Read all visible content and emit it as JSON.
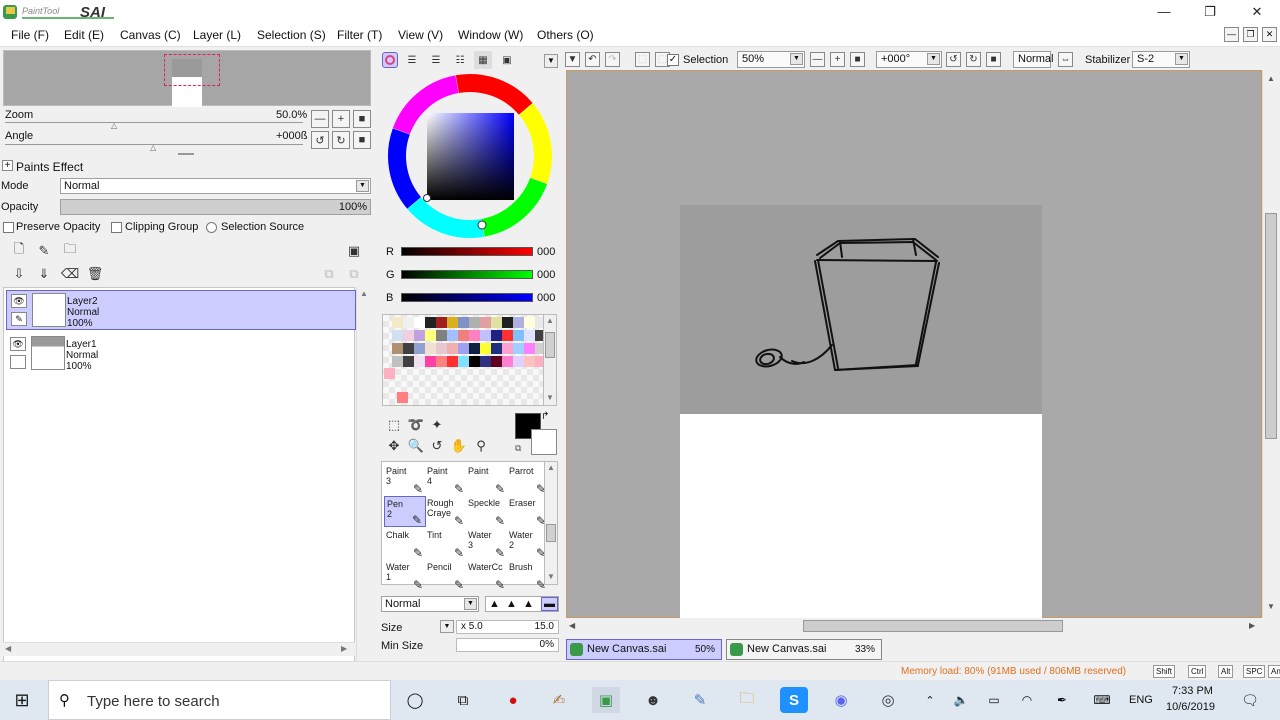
{
  "app": {
    "name": "SAI",
    "brand": "PaintTool"
  },
  "window_controls": {
    "minimize": "—",
    "restore": "❐",
    "close": "✕"
  },
  "menu": [
    "File (F)",
    "Edit (E)",
    "Canvas (C)",
    "Layer (L)",
    "Selection (S)",
    "Filter (T)",
    "View (V)",
    "Window (W)",
    "Others (O)"
  ],
  "navigator": {
    "zoom_label": "Zoom",
    "zoom_value": "50.0%",
    "angle_label": "Angle",
    "angle_value": "+000ß"
  },
  "layer_props": {
    "paints_effect": "Paints Effect",
    "mode_label": "Mode",
    "mode_value": "Normal",
    "opacity_label": "Opacity",
    "opacity_value": "100%",
    "preserve_opacity": "Preserve Opacity",
    "clipping_group": "Clipping Group",
    "selection_source": "Selection Source"
  },
  "layers": [
    {
      "name": "Layer2",
      "mode": "Normal",
      "opacity": "100%",
      "selected": true
    },
    {
      "name": "Layer1",
      "mode": "Normal",
      "opacity": "100%",
      "selected": false
    }
  ],
  "color": {
    "r_label": "R",
    "g_label": "G",
    "b_label": "B",
    "r_value": "000",
    "g_value": "000",
    "b_value": "000",
    "primary": "#000000"
  },
  "tools": [
    {
      "label": "Paint\n3"
    },
    {
      "label": "Paint\n4"
    },
    {
      "label": "Paint"
    },
    {
      "label": "Parrot"
    },
    {
      "label": "Pen\n2",
      "selected": true
    },
    {
      "label": "Rough\nCraye"
    },
    {
      "label": "Speckle"
    },
    {
      "label": "Eraser"
    },
    {
      "label": "Chalk"
    },
    {
      "label": "Tint"
    },
    {
      "label": "Water\n3"
    },
    {
      "label": "Water\n2"
    },
    {
      "label": "Water\n1"
    },
    {
      "label": "Pencil"
    },
    {
      "label": "WaterCc"
    },
    {
      "label": "Brush"
    }
  ],
  "brush": {
    "blend_mode": "Normal",
    "size_label": "Size",
    "size_mult": "x 5.0",
    "size_value": "15.0",
    "min_size_label": "Min Size",
    "min_size_value": "0%"
  },
  "canvas_toolbar": {
    "selection_label": "Selection",
    "zoom": "50%",
    "angle": "+000°",
    "blend": "Normal",
    "stabilizer_label": "Stabilizer",
    "stabilizer_value": "S-2"
  },
  "documents": [
    {
      "name": "New Canvas.sai",
      "zoom": "50%",
      "active": true
    },
    {
      "name": "New Canvas.sai",
      "zoom": "33%",
      "active": false
    }
  ],
  "status": {
    "memory": "Memory load: 80% (91MB used / 806MB reserved)",
    "keys": [
      "Shift",
      "Ctrl",
      "Alt",
      "SPC",
      "Any"
    ]
  },
  "taskbar": {
    "search_placeholder": "Type here to search",
    "language": "ENG",
    "time": "7:33 PM",
    "date": "10/6/2019"
  },
  "colors": {
    "selection_accent": "#ccccff",
    "memory_text": "#e07020",
    "canvas_bg": "#a9a9a9"
  }
}
